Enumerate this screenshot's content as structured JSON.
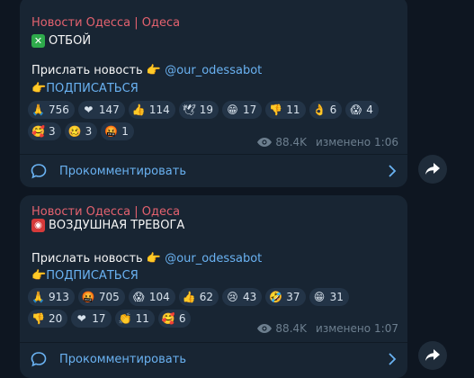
{
  "messages": [
    {
      "channel": "Новости Одесса | Одеса",
      "headline": "ОТБОЙ",
      "headline_icon": "cross-mark-icon",
      "line1_text": "Прислать новость",
      "line1_hand": "👉",
      "line1_link": "@our_odessabot",
      "line2_hand": "👉",
      "line2_text": "ПОДПИСАТЬСЯ",
      "reactions": [
        [
          {
            "icon": "🙏",
            "count": "756"
          },
          {
            "icon": "❤",
            "count": "147"
          },
          {
            "icon": "👍",
            "count": "114"
          },
          {
            "icon": "🕊",
            "count": "19"
          },
          {
            "icon": "😁",
            "count": "17"
          },
          {
            "icon": "👎",
            "count": "11"
          },
          {
            "icon": "👌",
            "count": "6"
          },
          {
            "icon": "😱",
            "count": "4"
          }
        ],
        [
          {
            "icon": "🥰",
            "count": "3"
          },
          {
            "icon": "🥴",
            "count": "3"
          },
          {
            "icon": "🤬",
            "count": "1"
          }
        ]
      ],
      "views": "88.4K",
      "edited_label": "изменено",
      "time": "1:06",
      "comment_label": "Прокомментировать"
    },
    {
      "channel": "Новости Одесса | Одеса",
      "headline": "ВОЗДУШНАЯ ТРЕВОГА",
      "headline_icon": "siren-icon",
      "line1_text": "Прислать новость",
      "line1_hand": "👉",
      "line1_link": "@our_odessabot",
      "line2_hand": "👉",
      "line2_text": "ПОДПИСАТЬСЯ",
      "reactions": [
        [
          {
            "icon": "🙏",
            "count": "913"
          },
          {
            "icon": "🤬",
            "count": "705"
          },
          {
            "icon": "😱",
            "count": "104"
          },
          {
            "icon": "👍",
            "count": "62"
          },
          {
            "icon": "😢",
            "count": "43"
          },
          {
            "icon": "🤣",
            "count": "37"
          },
          {
            "icon": "😁",
            "count": "31"
          }
        ],
        [
          {
            "icon": "👎",
            "count": "20"
          },
          {
            "icon": "❤",
            "count": "17"
          },
          {
            "icon": "👏",
            "count": "11"
          },
          {
            "icon": "🥰",
            "count": "6"
          }
        ]
      ],
      "views": "88.4K",
      "edited_label": "изменено",
      "time": "1:07",
      "comment_label": "Прокомментировать"
    }
  ],
  "colors": {
    "background": "#0e1621",
    "bubble": "#182533",
    "channel_name": "#e4626f",
    "link": "#6ab2f2",
    "reaction_bg": "#233447",
    "meta": "#6d7f8f"
  }
}
